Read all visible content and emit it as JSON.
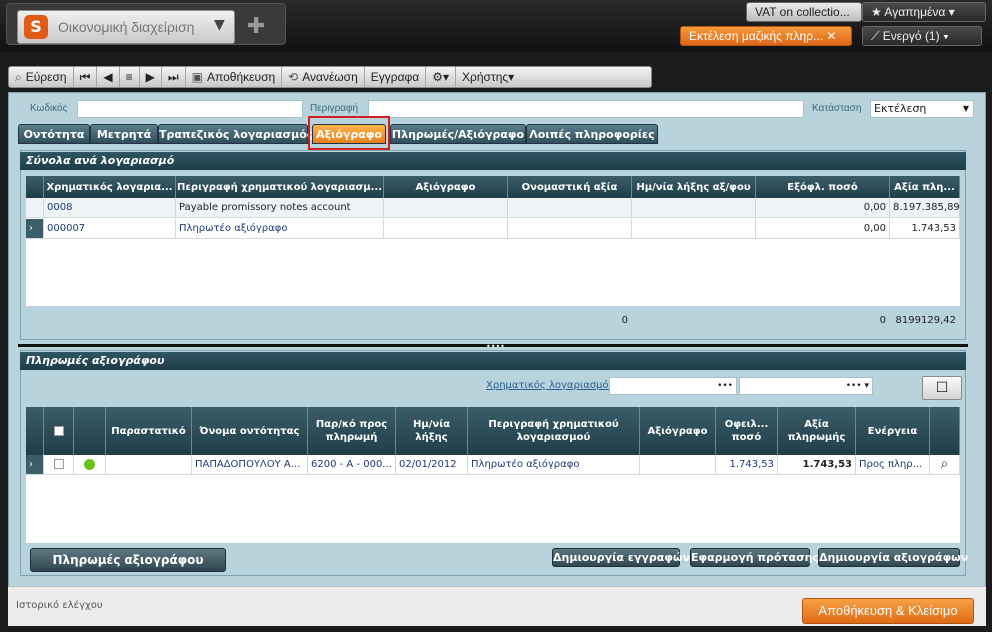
{
  "header": {
    "module_title": "Οικονομική διαχείριση",
    "vat_pill": "VAT on collectio...",
    "favorites": "★ Αγαπημένα",
    "batch_run": "Εκτέλεση μαζικής πληρ...",
    "active": "Ενεργό (1)"
  },
  "toolbar": {
    "find": "Εύρεση",
    "save": "Αποθήκευση",
    "refresh": "Ανανέωση",
    "registration": "Εγγραφα",
    "users": "Χρήστης"
  },
  "form": {
    "code_label": "Κωδικός",
    "code_value": "",
    "desc_label": "Περιγραφή",
    "desc_value": "",
    "status_label": "Κατάσταση",
    "status_value": "Εκτέλεση"
  },
  "tabs": [
    "Οντότητα",
    "Μετρητά",
    "Τραπεζικός λογαριασμός",
    "Αξιόγραφο",
    "Πληρωμές/Αξιόγραφο",
    "Λοιπές πληροφορίες"
  ],
  "totals": {
    "title": "Σύνολα ανά λογαριασμό",
    "columns": [
      "Χρηματικός λογαρια...",
      "Περιγραφή χρηματικού λογαριασμ...",
      "Αξιόγραφο",
      "Ονομαστική αξία",
      "Ημ/νία λήξης αξ/φου",
      "Εξόφλ. ποσό",
      "Αξία πλη..."
    ],
    "rows": [
      [
        "0008",
        "Payable promissory notes account",
        "",
        "",
        "",
        "0,00",
        "8.197.385,89"
      ],
      [
        "000007",
        "Πληρωτέο αξιόγραφο",
        "",
        "",
        "",
        "0,00",
        "1.743,53"
      ]
    ],
    "footer": [
      "0",
      "0",
      "8199129,42"
    ]
  },
  "payments": {
    "title": "Πληρωμές αξιογράφου",
    "filter_label": "Χρηματικός λογαριασμός",
    "columns": [
      "",
      "",
      "Παραστατικό",
      "Όνομα οντότητας",
      "Παρ/κό προς πληρωμή",
      "Ημ/νία λήξης",
      "Περιγραφή χρηματικού λογαριασμού",
      "Αξιόγραφο",
      "Οφειλ... ποσό",
      "Αξία πληρωμής",
      "Ενέργεια"
    ],
    "rows": [
      [
        "",
        "",
        "",
        "ΠΑΠΑΔΟΠΟΥΛΟΥ Α...",
        "6200 - A - 000...",
        "02/01/2012",
        "Πληρωτέο αξιόγραφο",
        "",
        "1.743,53",
        "1.743,53",
        "Προς πληρ..."
      ]
    ],
    "btn_payments": "Πληρωμές αξιογράφου",
    "btn_create_entries": "Δημιουργία εγγραφών",
    "btn_apply": "Εφαρμογή πρότασης",
    "btn_create_notes": "Δημιουργία αξιογράφων"
  },
  "footer": {
    "audit": "Ιστορικό ελέγχου",
    "save_close": "Αποθήκευση & Κλείσιμο"
  },
  "colors": {
    "accent": "#e7801c",
    "panel": "#b9d3dc",
    "header": "#1e3d47"
  }
}
